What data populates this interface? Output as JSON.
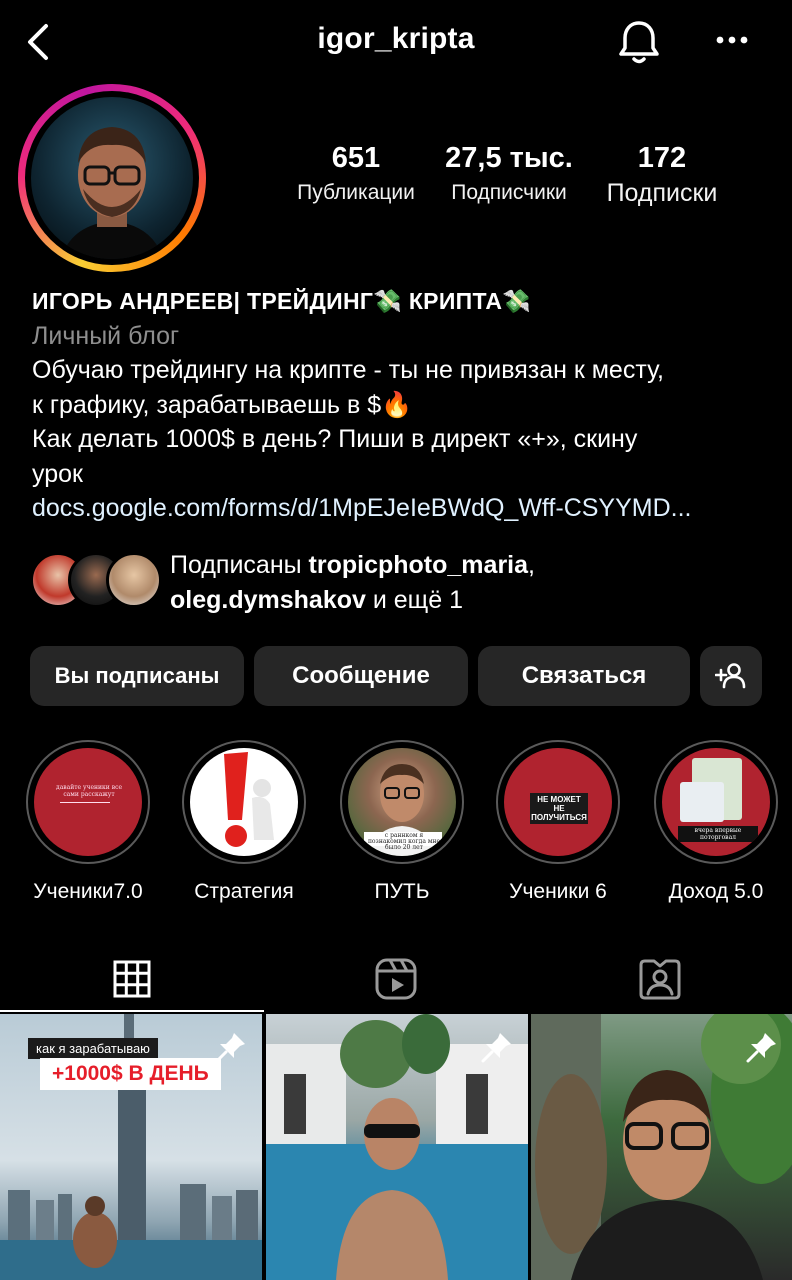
{
  "header": {
    "username": "igor_kripta",
    "back_icon": "chevron-left-icon",
    "bell_icon": "bell-icon",
    "more_icon": "more-horizontal-icon"
  },
  "stats": [
    {
      "value": "651",
      "label": "Публикации"
    },
    {
      "value": "27,5 тыс.",
      "label": "Подписчики"
    },
    {
      "value": "172",
      "label": "Подписки"
    }
  ],
  "bio": {
    "name": "ИГОРЬ АНДРЕЕВ| ТРЕЙДИНГ💸 КРИПТА💸",
    "category": "Личный блог",
    "line1": "Обучаю трейдингу на крипте - ты не привязан к месту,",
    "line2": "к графику, зарабатываешь в $🔥",
    "line3": "Как делать 1000$ в день? Пиши в директ «+», скину",
    "line4": "урок",
    "link": "docs.google.com/forms/d/1MpEJeIeBWdQ_Wff-CSYYMD..."
  },
  "followed_by": {
    "prefix": "Подписаны ",
    "user1": "tropicphoto_maria",
    "comma": ",",
    "user2": "oleg.dymshakov",
    "suffix": " и ещё 1"
  },
  "buttons": {
    "following": "Вы подписаны",
    "message": "Сообщение",
    "contact": "Связаться",
    "add_icon": "add-person-icon"
  },
  "highlights": [
    {
      "label": "Ученики7.0",
      "cover_text": "давайте ученики все сами расскажут"
    },
    {
      "label": "Стратегия",
      "cover_text": ""
    },
    {
      "label": "ПУТЬ",
      "cover_text": "с раннком я познакомил когда мне было 20 лет"
    },
    {
      "label": "Ученики 6",
      "cover_text": "НЕ МОЖЕТ НЕ ПОЛУЧИТЬСЯ"
    },
    {
      "label": "Доход 5.0",
      "cover_text": "вчера впервые поторговал"
    }
  ],
  "tabs": {
    "grid_icon": "grid-icon",
    "reels_icon": "reels-icon",
    "tagged_icon": "tagged-icon"
  },
  "posts": [
    {
      "caption_top": "как я зарабатываю",
      "caption_main": "+1000$ В ДЕНЬ",
      "pinned": true
    },
    {
      "pinned": true
    },
    {
      "pinned": true
    }
  ],
  "colors": {
    "background": "#000000",
    "button_bg": "#262626",
    "secondary_text": "#8e8e8e",
    "link_text": "#e0f1ff",
    "highlight_red": "#b0232f"
  }
}
